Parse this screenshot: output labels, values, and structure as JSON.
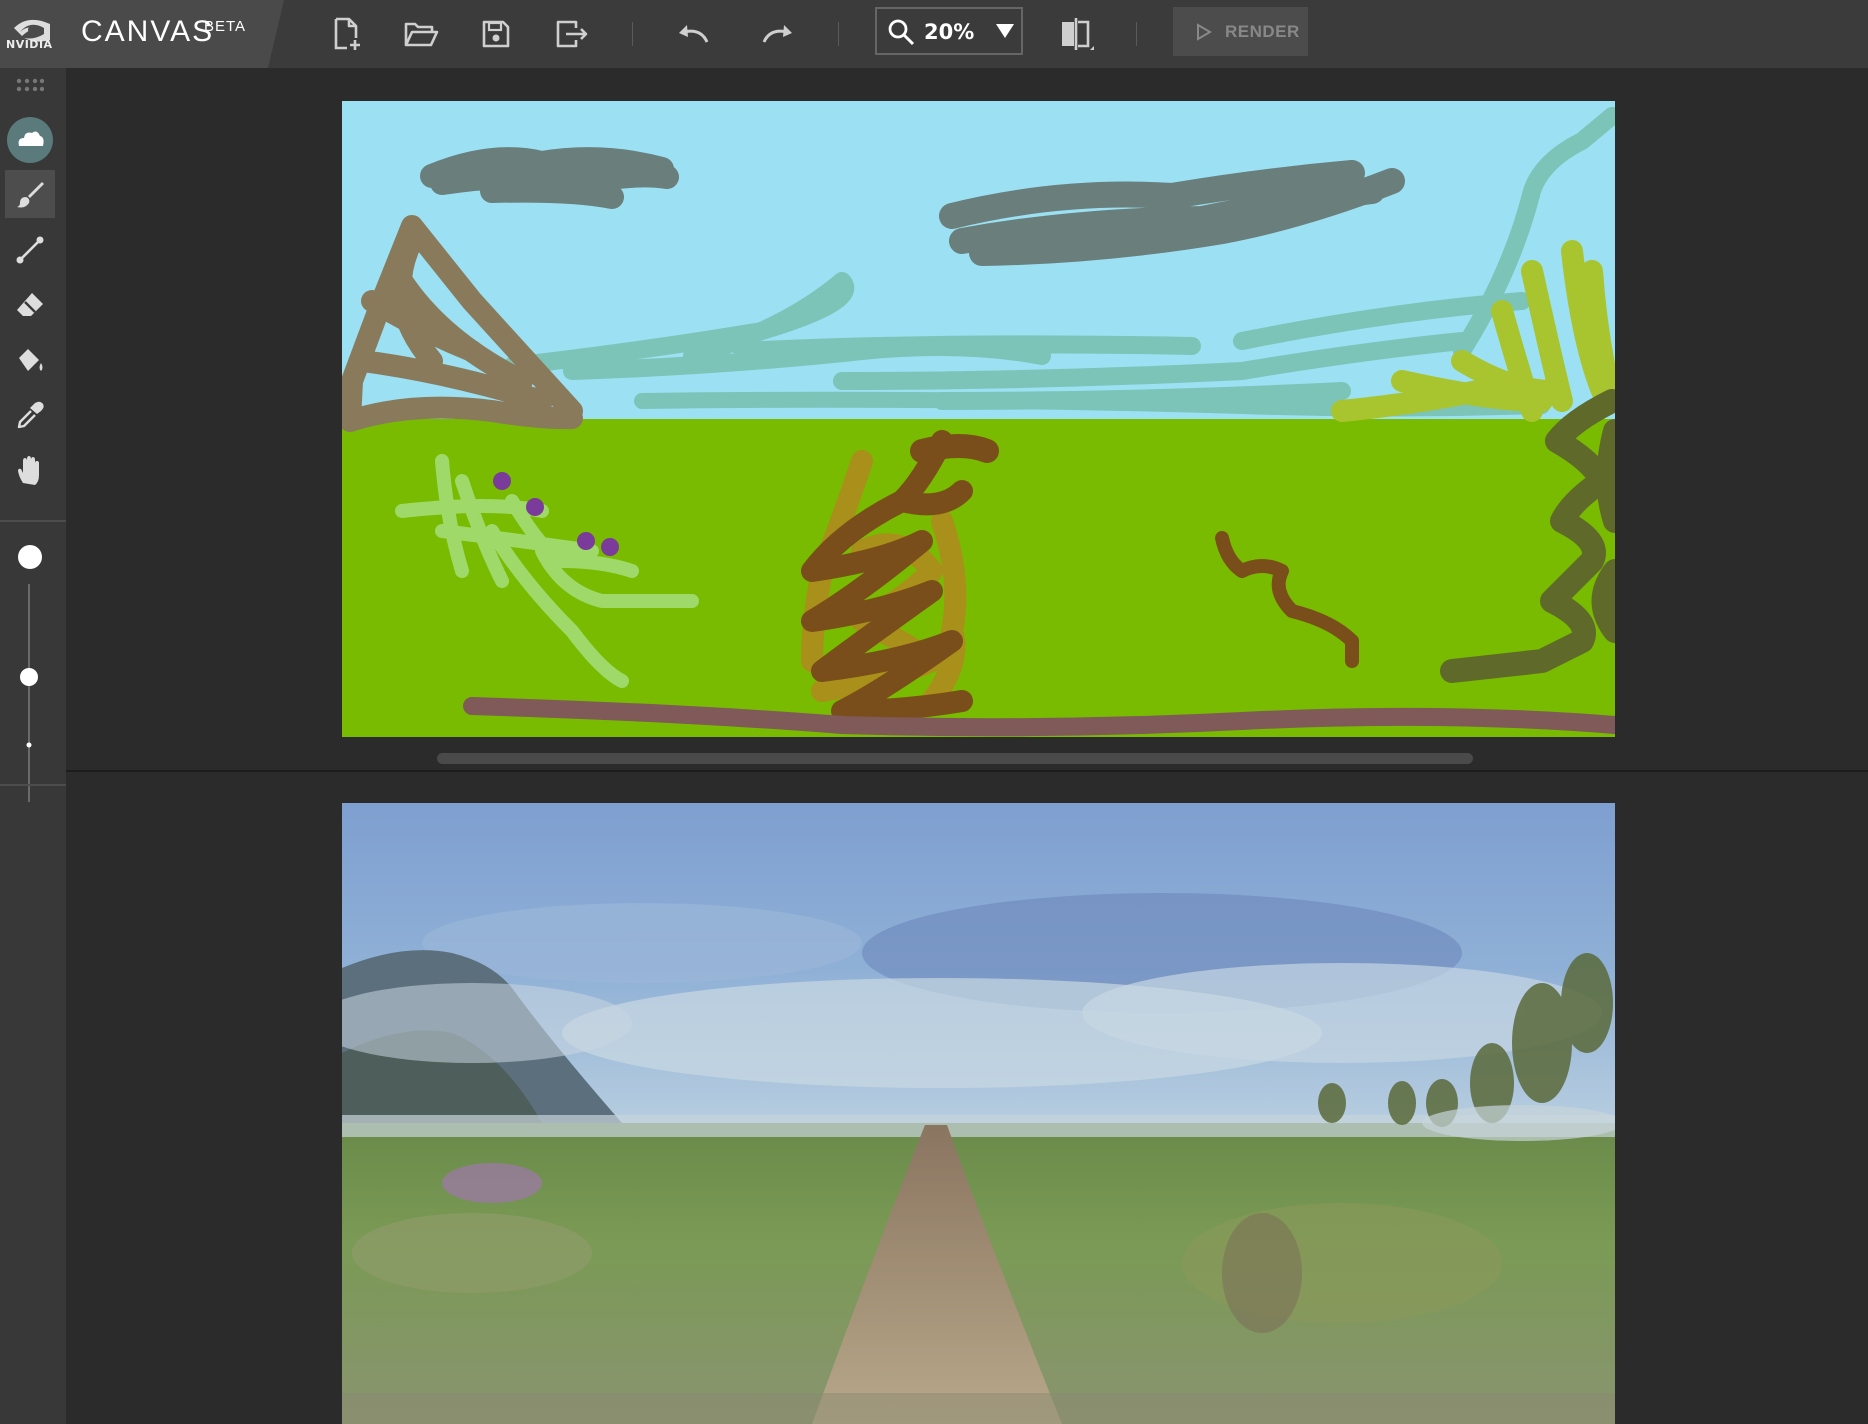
{
  "brand": {
    "company": "NVIDIA",
    "title": "CANVAS",
    "badge": "BETA"
  },
  "toolbar": {
    "buttons": [
      {
        "name": "new-file",
        "icon": "new-file-icon"
      },
      {
        "name": "open",
        "icon": "folder-open-icon"
      },
      {
        "name": "save",
        "icon": "save-icon"
      },
      {
        "name": "export",
        "icon": "export-icon"
      },
      {
        "name": "undo",
        "icon": "undo-icon"
      },
      {
        "name": "redo",
        "icon": "redo-icon"
      },
      {
        "name": "compare",
        "icon": "split-view-icon"
      }
    ],
    "zoom": {
      "value": "20%",
      "icon": "magnifier-icon"
    },
    "render": {
      "label": "RENDER",
      "enabled": false
    }
  },
  "tools": {
    "items": [
      {
        "name": "materials",
        "icon": "cloud-icon",
        "selected": true
      },
      {
        "name": "brush",
        "icon": "brush-icon",
        "selected": true
      },
      {
        "name": "line",
        "icon": "line-icon"
      },
      {
        "name": "eraser",
        "icon": "eraser-icon"
      },
      {
        "name": "fill",
        "icon": "paint-bucket-icon"
      },
      {
        "name": "eyedropper",
        "icon": "eyedropper-icon"
      },
      {
        "name": "pan",
        "icon": "hand-icon"
      }
    ],
    "brush_size": 0.25
  },
  "colors": {
    "topbar": "#3b3b3b",
    "brand_panel": "#4a4a4a",
    "background": "#2b2b2b",
    "sky": "#9be1f3",
    "grass": "#79bb00",
    "cloud": "#6a7e7b",
    "mountain": "#8a7a5c",
    "fog": "#7cc4b8",
    "tree": "#a8c42f",
    "dark_tree": "#5f6a2a",
    "dirt": "#7a4e1a",
    "bush": "#a8901a",
    "flowers": "#9fd96a",
    "flower_dots": "#7a3b9a",
    "path": "#7f5a58"
  }
}
